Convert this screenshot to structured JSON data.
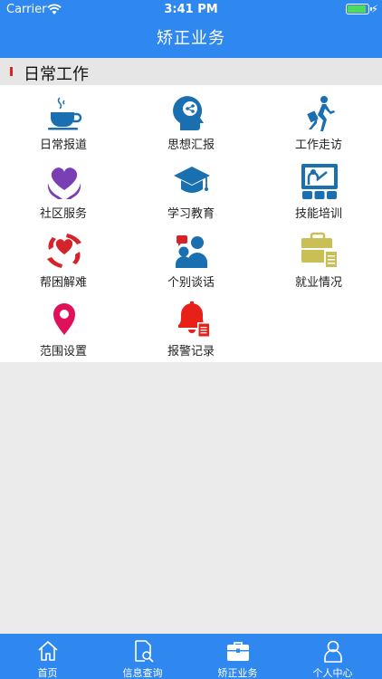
{
  "status_bar": {
    "carrier": "Carrier",
    "time": "3:41 PM"
  },
  "nav": {
    "title": "矫正业务"
  },
  "section": {
    "title": "日常工作"
  },
  "grid": {
    "items": [
      {
        "label": "日常报道",
        "icon": "coffee-cup-icon"
      },
      {
        "label": "思想汇报",
        "icon": "head-thought-icon"
      },
      {
        "label": "工作走访",
        "icon": "walking-person-icon"
      },
      {
        "label": "社区服务",
        "icon": "heart-hands-icon"
      },
      {
        "label": "学习教育",
        "icon": "graduation-cap-icon"
      },
      {
        "label": "技能培训",
        "icon": "presentation-board-icon"
      },
      {
        "label": "帮困解难",
        "icon": "helping-hands-icon"
      },
      {
        "label": "个别谈话",
        "icon": "conversation-icon"
      },
      {
        "label": "就业情况",
        "icon": "briefcase-document-icon"
      },
      {
        "label": "范围设置",
        "icon": "location-pin-icon"
      },
      {
        "label": "报警记录",
        "icon": "alarm-bell-icon"
      }
    ]
  },
  "tabbar": {
    "tabs": [
      {
        "label": "首页",
        "icon": "home-icon"
      },
      {
        "label": "信息查询",
        "icon": "search-document-icon"
      },
      {
        "label": "矫正业务",
        "icon": "briefcase-icon",
        "active": true
      },
      {
        "label": "个人中心",
        "icon": "user-icon"
      }
    ]
  },
  "colors": {
    "primary": "#2f87f0",
    "accent_red": "#e8201a",
    "icon_blue": "#1a6fb0",
    "icon_purple": "#7b3fb5",
    "icon_olive": "#c9bf55",
    "icon_pink": "#e0105a"
  }
}
